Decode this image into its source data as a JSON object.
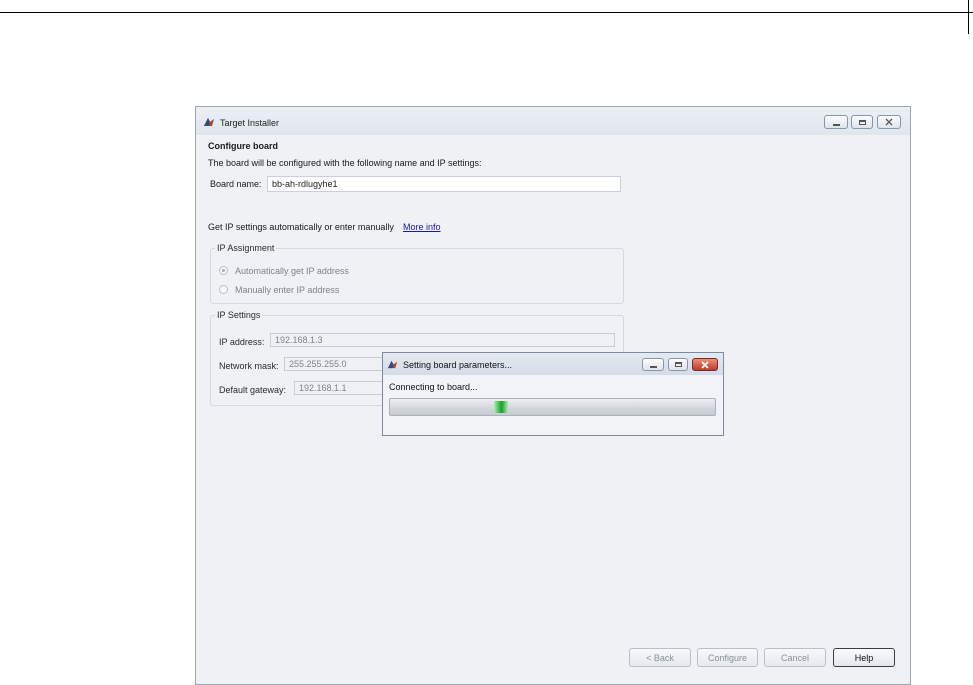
{
  "window": {
    "title": "Target Installer",
    "heading": "Configure board",
    "description": "The board will be configured with the following name and IP settings:",
    "board_name_label": "Board name:",
    "board_name_value": "bb-ah-rdlugyhe1",
    "ip_prompt": "Get IP settings automatically or enter manually",
    "more_info_link": "More info",
    "ip_assignment": {
      "title": "IP Assignment",
      "option_auto": "Automatically get IP address",
      "option_manual": "Manually enter IP address",
      "selected": "auto"
    },
    "ip_settings": {
      "title": "IP Settings",
      "ip_address_label": "IP address:",
      "ip_address_value": "192.168.1.3",
      "network_mask_label": "Network mask:",
      "network_mask_value": "255.255.255.0",
      "default_gateway_label": "Default gateway:",
      "default_gateway_value": "192.168.1.1"
    },
    "buttons": {
      "back": "< Back",
      "configure": "Configure",
      "cancel": "Cancel",
      "help": "Help"
    }
  },
  "progress_dialog": {
    "title": "Setting board parameters...",
    "message": "Connecting to board...",
    "state": "indeterminate"
  },
  "colors": {
    "link": "#1a1aa8",
    "progress_green": "#23b33a",
    "close_red": "#c0392b",
    "window_bg": "#eff1f4"
  }
}
